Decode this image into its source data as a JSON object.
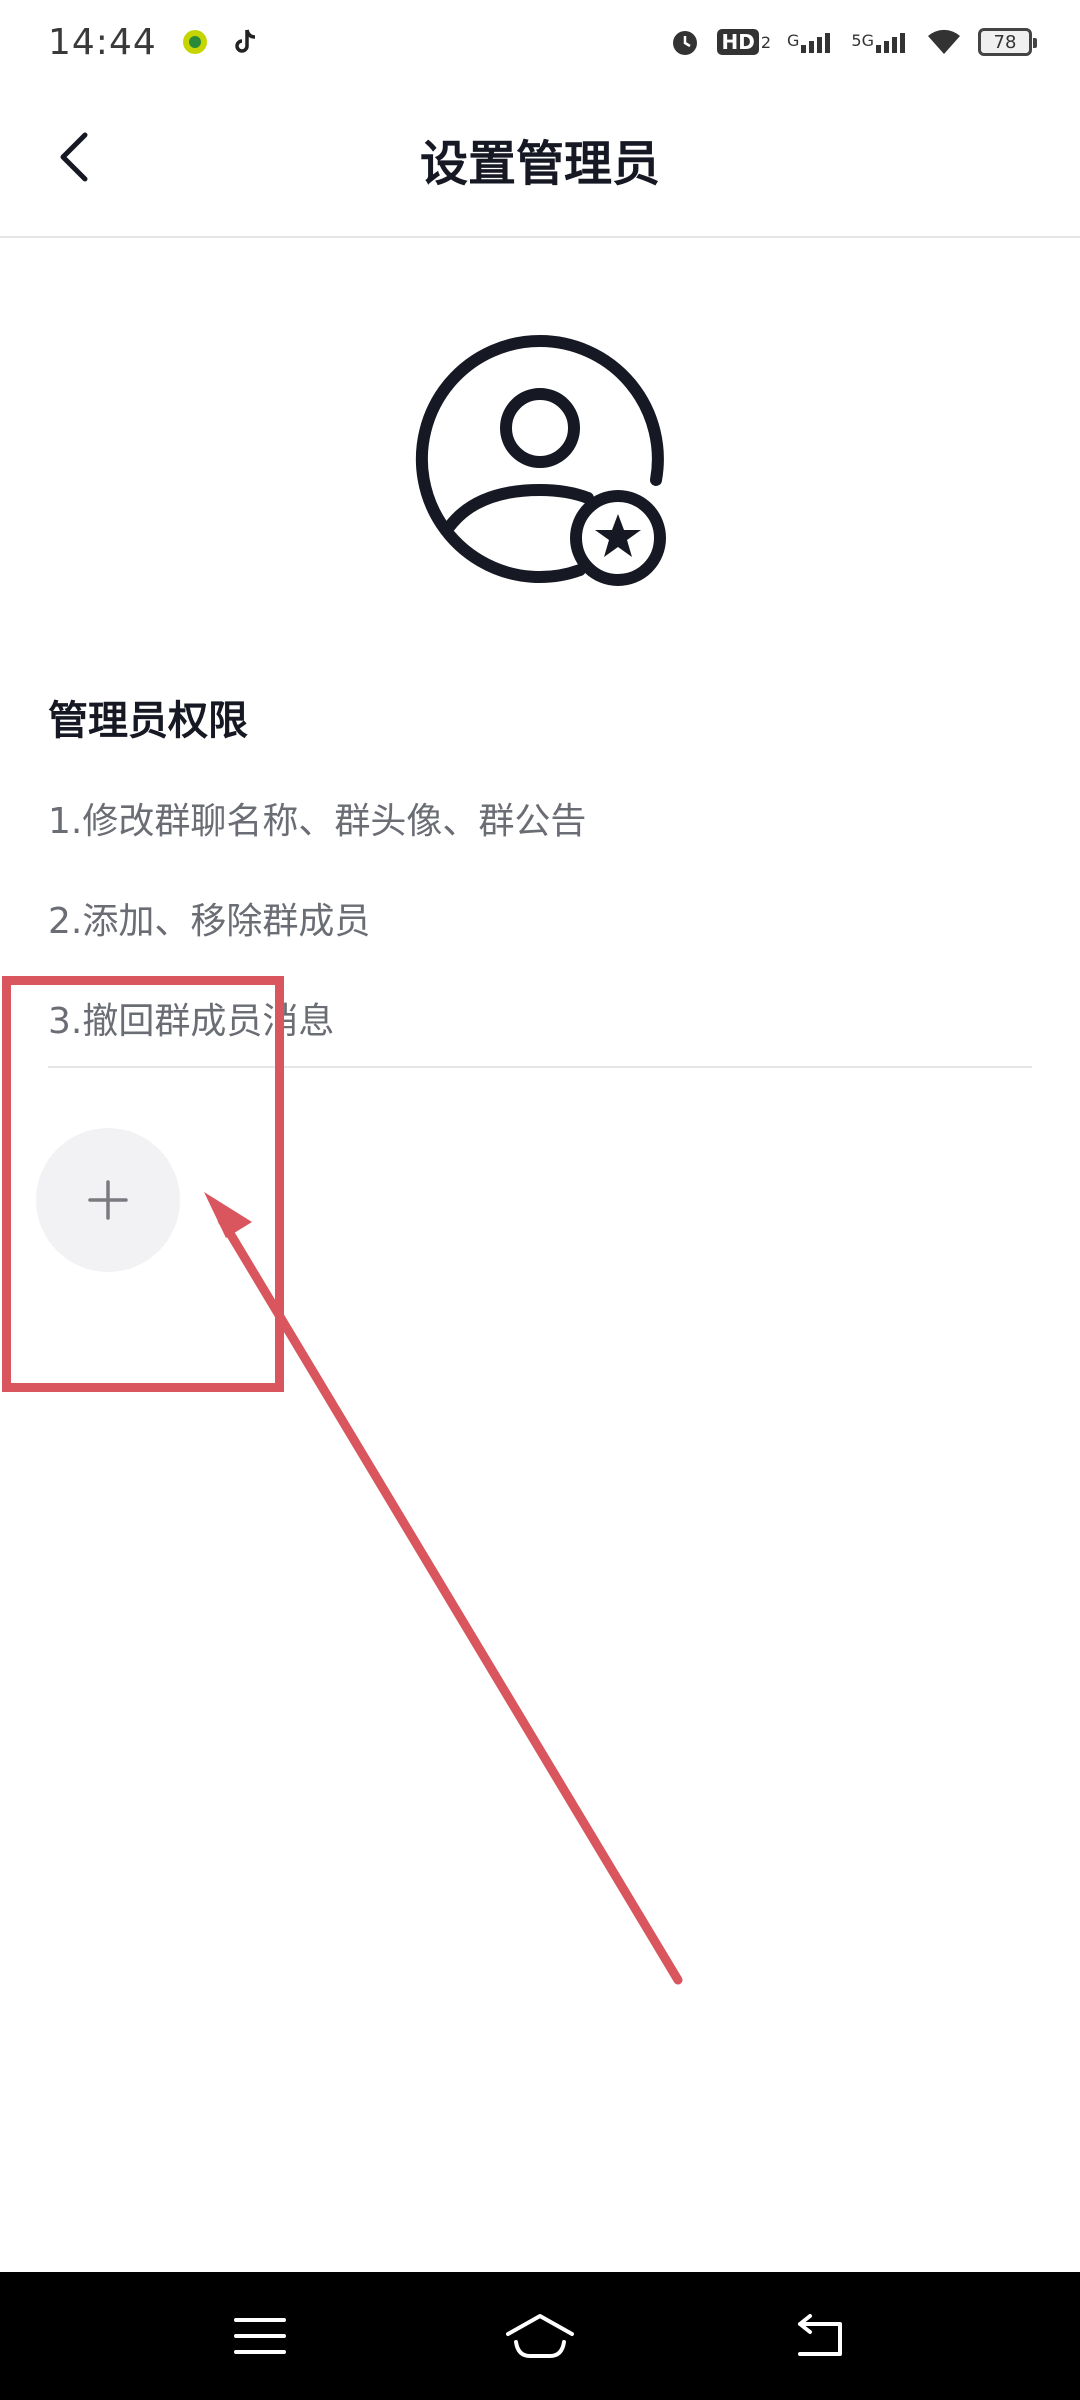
{
  "status_bar": {
    "time": "14:44",
    "network_gen": "G",
    "network_5g": "5G",
    "hd_label": "HD",
    "hd_sub": "2",
    "battery": "78"
  },
  "header": {
    "title": "设置管理员"
  },
  "permissions": {
    "title": "管理员权限",
    "items": [
      "1.修改群聊名称、群头像、群公告",
      "2.添加、移除群成员",
      "3.撤回群成员消息"
    ]
  },
  "colors": {
    "annotation": "#d9565e",
    "text_primary": "#161823",
    "text_secondary": "#6b6d75"
  }
}
